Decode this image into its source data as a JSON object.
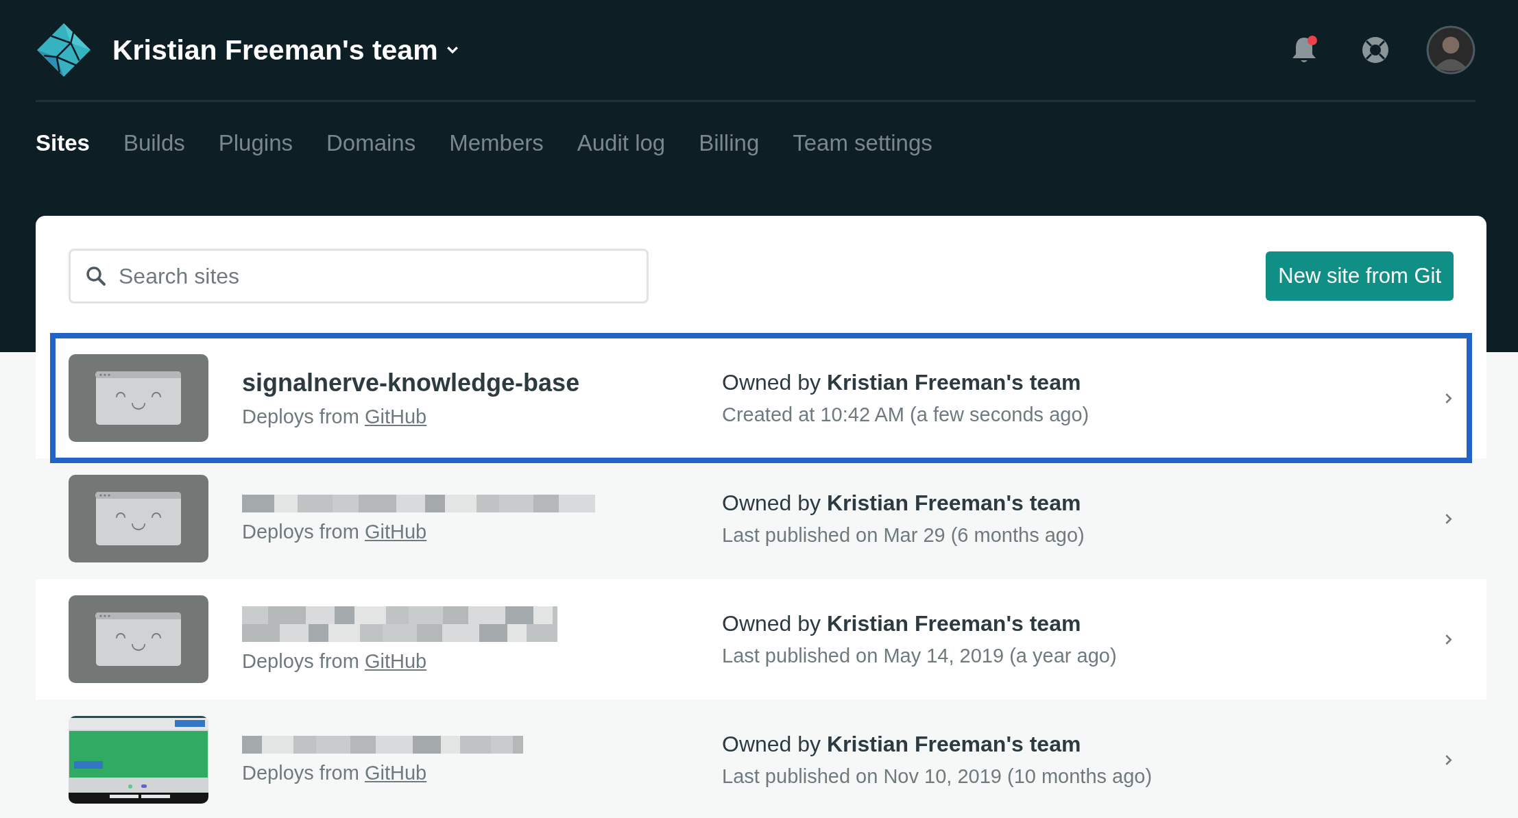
{
  "team": {
    "name": "Kristian Freeman's team"
  },
  "notifications": {
    "unread": true
  },
  "nav": [
    {
      "label": "Sites",
      "selected": true
    },
    {
      "label": "Builds",
      "selected": false
    },
    {
      "label": "Plugins",
      "selected": false
    },
    {
      "label": "Domains",
      "selected": false
    },
    {
      "label": "Members",
      "selected": false
    },
    {
      "label": "Audit log",
      "selected": false
    },
    {
      "label": "Billing",
      "selected": false
    },
    {
      "label": "Team settings",
      "selected": false
    }
  ],
  "search": {
    "placeholder": "Search sites"
  },
  "new_site_button": "New site from Git",
  "sites": [
    {
      "name": "signalnerve-knowledge-base",
      "name_blurred": false,
      "thumbnail": {
        "kind": "placeholder"
      },
      "selected": true,
      "deploys": "Deploys from",
      "provider": "GitHub",
      "owner": "Owned by **Kristian Freeman's team**",
      "status": "Created at 10:42 AM (a few seconds ago)"
    },
    {
      "name_blurred": true,
      "thumbnail": {
        "kind": "placeholder"
      },
      "selected": false,
      "deploys": "Deploys from",
      "provider": "GitHub",
      "owner": "Owned by **Kristian Freeman's team**",
      "status": "Last published on Mar 29 (6 months ago)"
    },
    {
      "name_blurred": true,
      "thumbnail": {
        "kind": "placeholder"
      },
      "selected": false,
      "deploys": "Deploys from",
      "provider": "GitHub",
      "owner": "Owned by **Kristian Freeman's team**",
      "status": "Last published on May 14, 2019 (a year ago)"
    },
    {
      "name_blurred": true,
      "selected": false,
      "deploys": "Deploys from",
      "provider": "GitHub",
      "owner": "Owned by **Kristian Freeman's team**",
      "status": "Last published on Nov 10, 2019 (10 months ago)"
    }
  ]
}
